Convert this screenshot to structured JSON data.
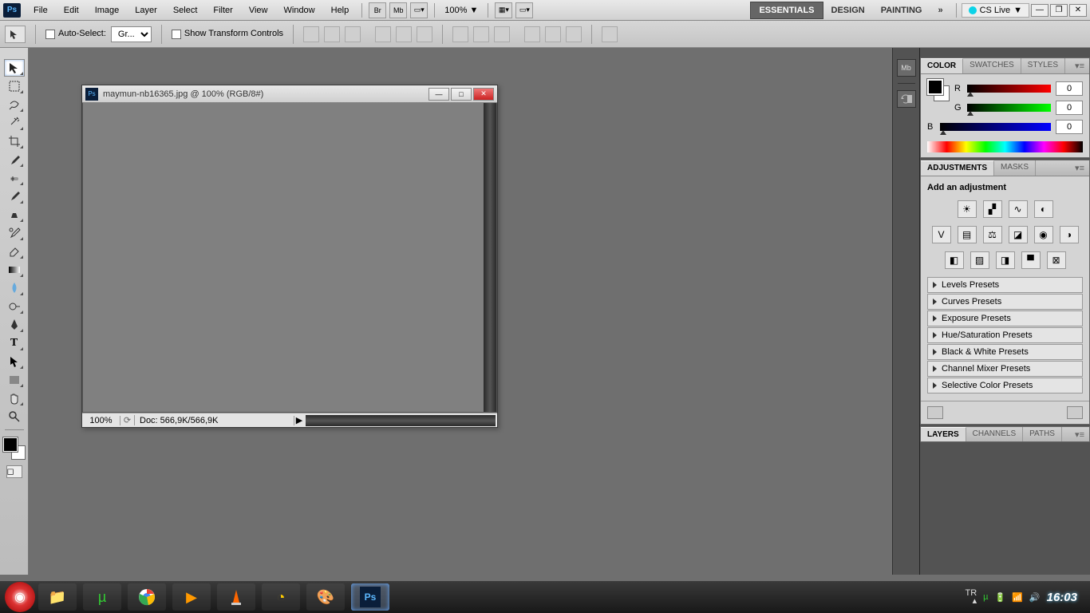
{
  "menubar": {
    "logo": "Ps",
    "items": [
      "File",
      "Edit",
      "Image",
      "Layer",
      "Select",
      "Filter",
      "View",
      "Window",
      "Help"
    ],
    "zoom": "100%",
    "workspaces": [
      "ESSENTIALS",
      "DESIGN",
      "PAINTING"
    ],
    "cslive": "CS Live"
  },
  "optbar": {
    "auto_select": "Auto-Select:",
    "auto_select_val": "Gr...",
    "show_transform": "Show Transform Controls"
  },
  "doc": {
    "title": "maymun-nb16365.jpg @ 100% (RGB/8#)",
    "zoom": "100%",
    "docinfo": "Doc: 566,9K/566,9K"
  },
  "panels": {
    "color": {
      "tabs": [
        "COLOR",
        "SWATCHES",
        "STYLES"
      ],
      "r": "R",
      "g": "G",
      "b": "B",
      "rv": "0",
      "gv": "0",
      "bv": "0"
    },
    "adjustments": {
      "tabs": [
        "ADJUSTMENTS",
        "MASKS"
      ],
      "title": "Add an adjustment",
      "presets": [
        "Levels Presets",
        "Curves Presets",
        "Exposure Presets",
        "Hue/Saturation Presets",
        "Black & White Presets",
        "Channel Mixer Presets",
        "Selective Color Presets"
      ]
    },
    "layers": {
      "tabs": [
        "LAYERS",
        "CHANNELS",
        "PATHS"
      ]
    }
  },
  "taskbar": {
    "lang": "TR",
    "clock": "16:03"
  }
}
